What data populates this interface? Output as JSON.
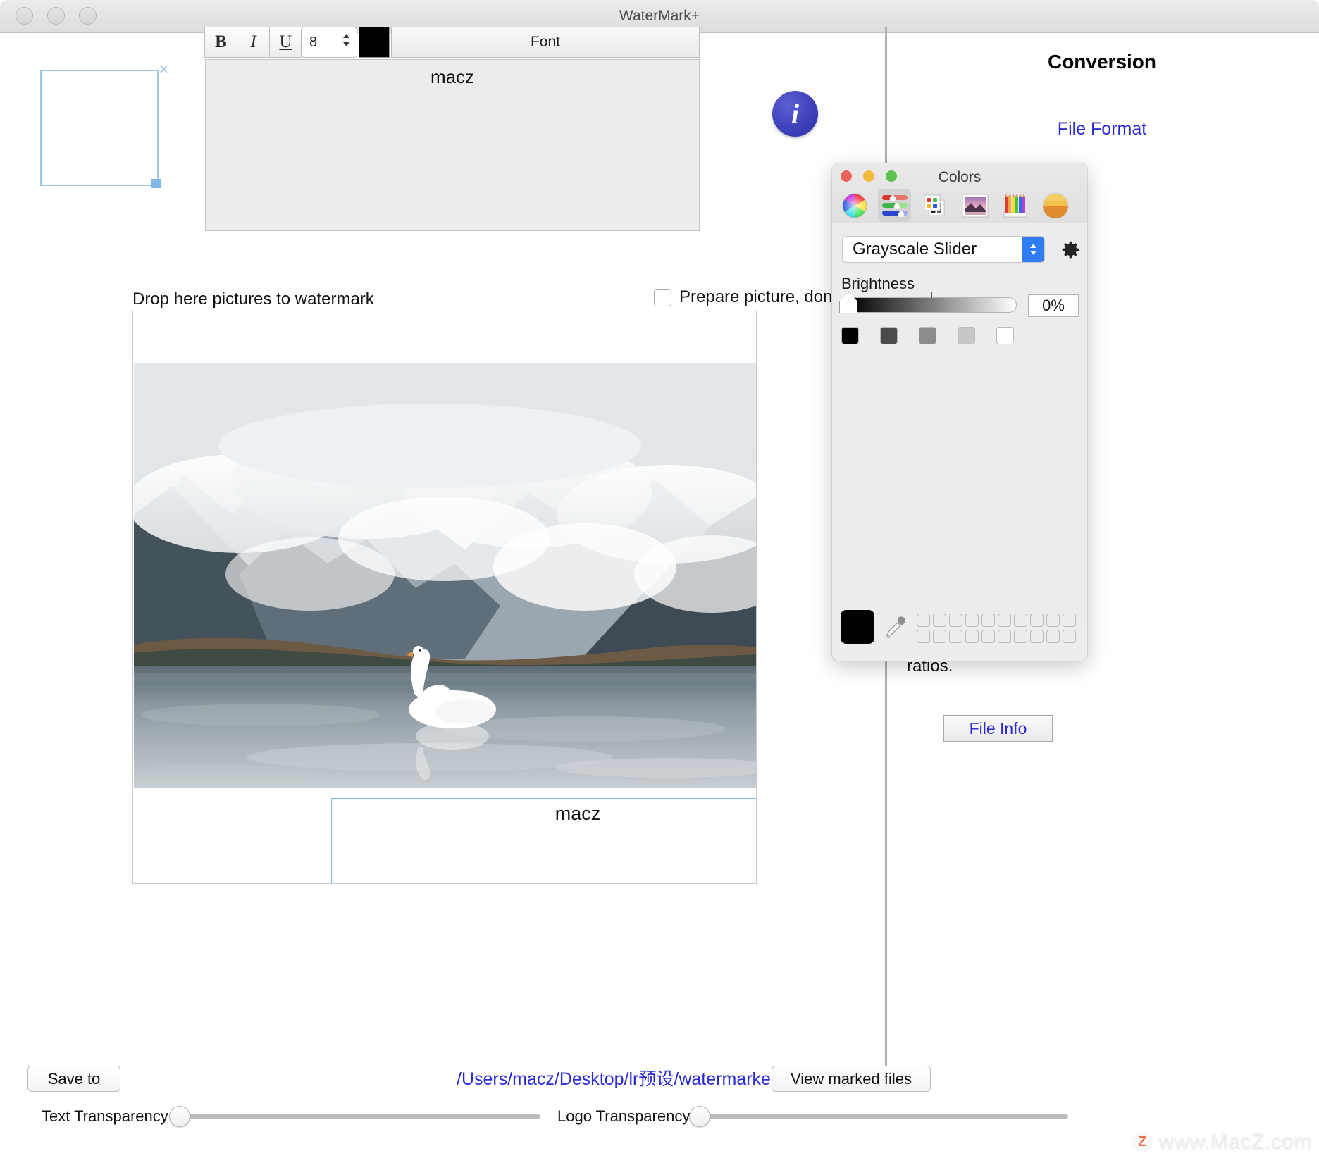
{
  "window": {
    "title": "WaterMark+",
    "traffic_lights": [
      "close",
      "minimize",
      "zoom"
    ]
  },
  "format_toolbar": {
    "bold_label": "B",
    "italic_label": "I",
    "underline_label": "U",
    "font_size": "8",
    "color_swatch": "#000000",
    "font_button_label": "Font"
  },
  "watermark_text_field": {
    "value": "macz"
  },
  "logo_drop_box": {
    "close_label": "×"
  },
  "info_button": {
    "glyph": "i"
  },
  "drop_area": {
    "label": "Drop here pictures to watermark",
    "prepare_checkbox_label": "Prepare picture, don't",
    "prepare_checked": false
  },
  "preview": {
    "watermark_overlay_text": "macz"
  },
  "bottom_bar": {
    "save_to_label": "Save to",
    "output_path": "/Users/macz/Desktop/lr预设/watermarked",
    "view_marked_files_label": "View marked files",
    "text_transparency_label": "Text Transparency",
    "logo_transparency_label": "Logo Transparency"
  },
  "sidebar": {
    "title": "Conversion",
    "file_format_label": "File Format",
    "ratios_text": "ratios.",
    "file_info_label": "File Info"
  },
  "colors_panel": {
    "title": "Colors",
    "traffic_lights": [
      "close",
      "minimize",
      "zoom"
    ],
    "tabs": [
      {
        "name": "color-wheel",
        "active": false
      },
      {
        "name": "color-sliders",
        "active": true
      },
      {
        "name": "color-palettes",
        "active": false
      },
      {
        "name": "image-palettes",
        "active": false
      },
      {
        "name": "pencils",
        "active": false
      },
      {
        "name": "color-preview",
        "active": false
      }
    ],
    "mode_popup_value": "Grayscale Slider",
    "gear_glyph": "⚙",
    "brightness_label": "Brightness",
    "brightness_value": "0%",
    "gray_swatches": [
      "#000000",
      "#4a4a4a",
      "#8c8c8c",
      "#c6c6c6",
      "#ffffff"
    ],
    "selected_color": "#000000",
    "swatch_grid_rows": 2,
    "swatch_grid_cols": 10
  },
  "watermark_brand": {
    "badge": "Z",
    "text": "www.MacZ.com"
  }
}
